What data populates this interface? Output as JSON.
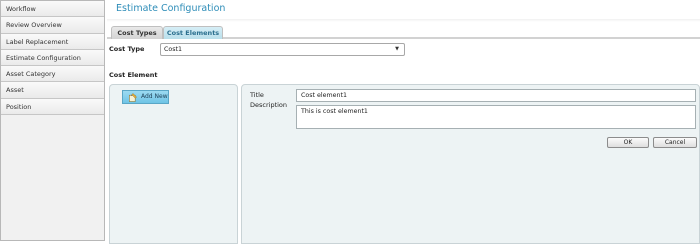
{
  "sidebar": {
    "items": [
      {
        "label": "Workflow"
      },
      {
        "label": "Review Overview"
      },
      {
        "label": "Label Replacement"
      },
      {
        "label": "Estimate Configuration"
      },
      {
        "label": "Asset Category"
      },
      {
        "label": "Asset"
      },
      {
        "label": "Position"
      }
    ]
  },
  "page": {
    "title": "Estimate Configuration"
  },
  "tabs": [
    {
      "label": "Cost Types",
      "active": false
    },
    {
      "label": "Cost Elements",
      "active": true
    }
  ],
  "cost_type": {
    "label": "Cost Type",
    "selected": "Cost1",
    "caret_icon": "chevron-down-icon"
  },
  "cost_element": {
    "heading": "Cost Element"
  },
  "toolbar": {
    "add_label": "Add New",
    "add_icon": "add-new-icon"
  },
  "form": {
    "title_label": "Title",
    "title_value": "Cost element1",
    "description_label": "Description",
    "description_value": "This is cost element1",
    "ok_label": "OK",
    "cancel_label": "Cancel"
  },
  "colors": {
    "accent": "#2e8db8",
    "add_button": "#7fcbe9",
    "panel_bg": "#edf3f4"
  }
}
